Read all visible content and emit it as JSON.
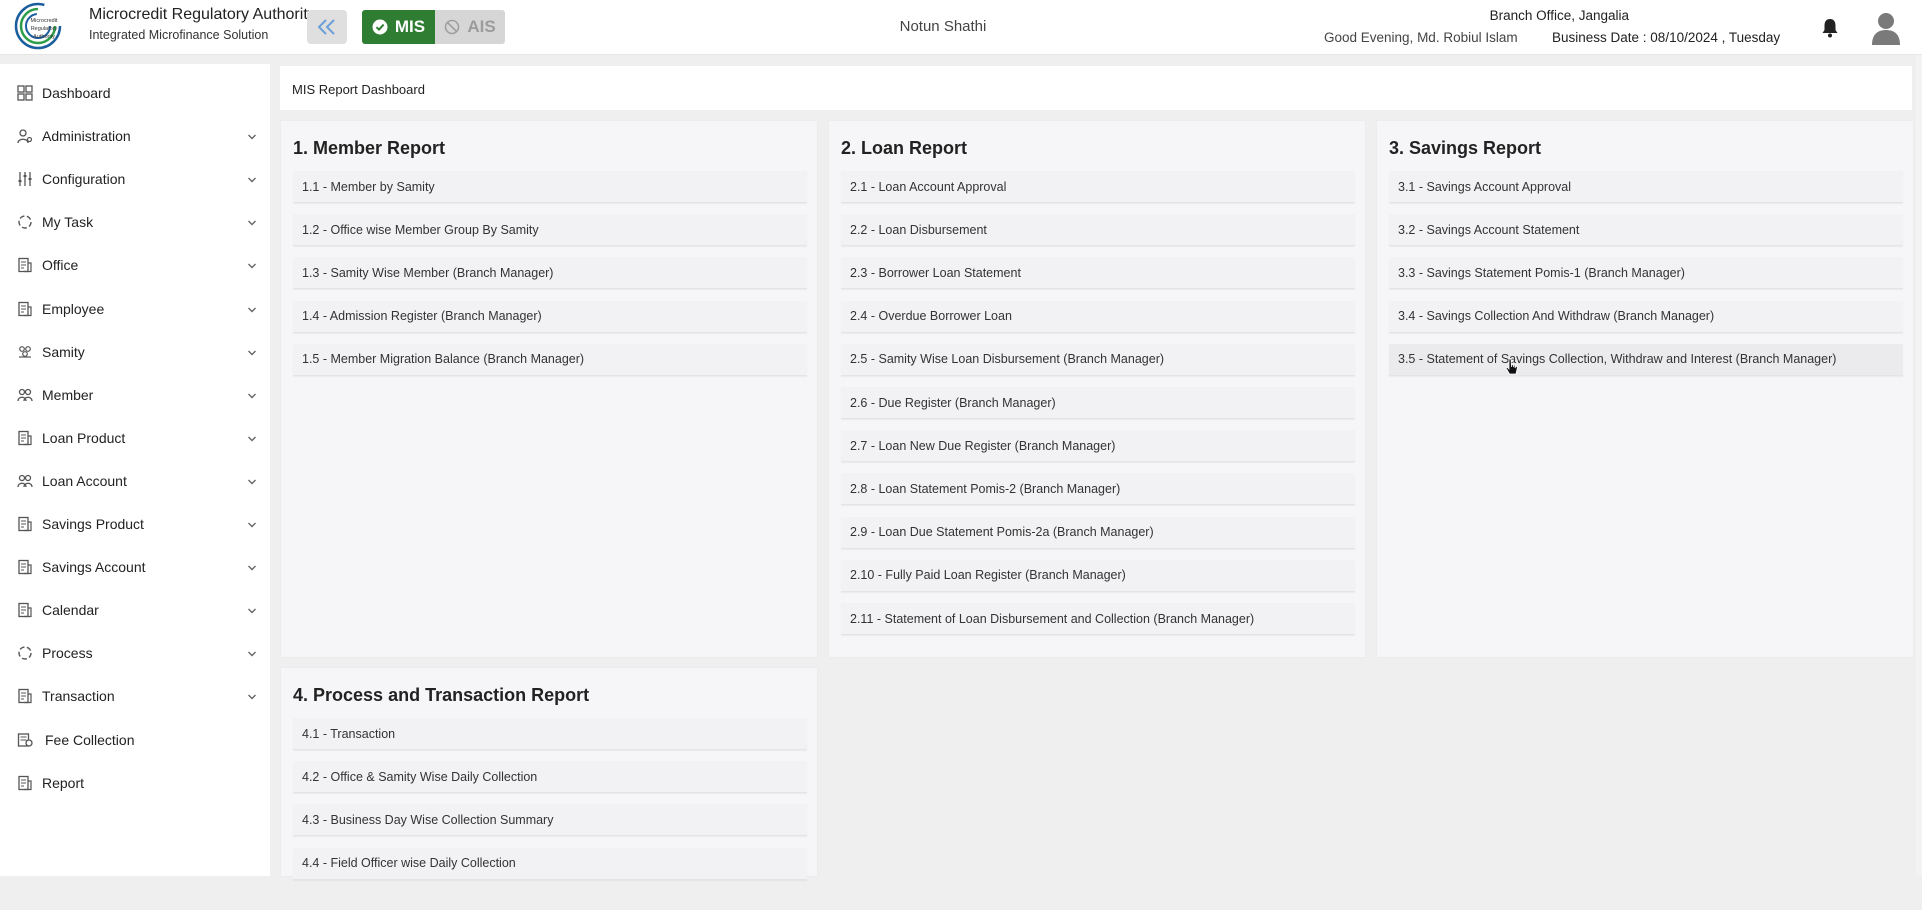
{
  "header": {
    "brand_title": "Microcredit Regulatory Authority",
    "brand_subtitle": "Integrated Microfinance Solution",
    "logo_text_lines": [
      "Microcredit",
      "Regulatory",
      "Authority"
    ],
    "mis_label": "MIS",
    "ais_label": "AIS",
    "center_title": "Notun Shathi",
    "greeting": "Good Evening, Md. Robiul Islam",
    "branch": "Branch Office, Jangalia",
    "business_date": "Business Date : 08/10/2024 , Tuesday",
    "accent_color": "#2e7d32"
  },
  "sidebar": {
    "items": [
      {
        "label": "Dashboard",
        "icon": "grid-icon",
        "expandable": false
      },
      {
        "label": "Administration",
        "icon": "user-gear-icon",
        "expandable": true
      },
      {
        "label": "Configuration",
        "icon": "sliders-icon",
        "expandable": true
      },
      {
        "label": "My Task",
        "icon": "circle-dashed-icon",
        "expandable": true
      },
      {
        "label": "Office",
        "icon": "document-icon",
        "expandable": true
      },
      {
        "label": "Employee",
        "icon": "document-icon",
        "expandable": true
      },
      {
        "label": "Samity",
        "icon": "group-icon",
        "expandable": true
      },
      {
        "label": "Member",
        "icon": "users-icon",
        "expandable": true
      },
      {
        "label": "Loan Product",
        "icon": "document-icon",
        "expandable": true
      },
      {
        "label": "Loan Account",
        "icon": "users-icon",
        "expandable": true
      },
      {
        "label": "Savings Product",
        "icon": "document-icon",
        "expandable": true
      },
      {
        "label": "Savings Account",
        "icon": "document-icon",
        "expandable": true
      },
      {
        "label": "Calendar",
        "icon": "document-icon",
        "expandable": true
      },
      {
        "label": "Process",
        "icon": "circle-dashed-icon",
        "expandable": true
      },
      {
        "label": "Transaction",
        "icon": "document-icon",
        "expandable": true
      },
      {
        "label": "Fee Collection",
        "icon": "cash-icon",
        "expandable": false
      },
      {
        "label": "Report",
        "icon": "document-icon",
        "expandable": false
      }
    ]
  },
  "main": {
    "page_title": "MIS Report Dashboard",
    "panels": [
      {
        "title": "1. Member Report",
        "items": [
          "1.1 - Member by Samity",
          "1.2 - Office wise Member Group By Samity",
          "1.3 - Samity Wise Member (Branch Manager)",
          "1.4 - Admission Register (Branch Manager)",
          "1.5 - Member Migration Balance (Branch Manager)"
        ]
      },
      {
        "title": "2. Loan Report",
        "items": [
          "2.1 - Loan Account Approval",
          "2.2 - Loan Disbursement",
          "2.3 - Borrower Loan Statement",
          "2.4 - Overdue Borrower Loan",
          "2.5 - Samity Wise Loan Disbursement (Branch Manager)",
          "2.6 - Due Register (Branch Manager)",
          "2.7 - Loan New Due Register (Branch Manager)",
          "2.8 - Loan Statement Pomis-2 (Branch Manager)",
          "2.9 - Loan Due Statement Pomis-2a (Branch Manager)",
          "2.10 - Fully Paid Loan Register (Branch Manager)",
          "2.11 - Statement of Loan Disbursement and Collection (Branch Manager)"
        ]
      },
      {
        "title": "3. Savings Report",
        "items": [
          "3.1 - Savings Account Approval",
          "3.2 - Savings Account Statement",
          "3.3 - Savings Statement Pomis-1 (Branch Manager)",
          "3.4 - Savings Collection And Withdraw (Branch Manager)",
          "3.5 - Statement of Savings Collection, Withdraw and Interest (Branch Manager)"
        ]
      },
      {
        "title": "4. Process and Transaction Report",
        "items": [
          "4.1 - Transaction",
          "4.2 - Office & Samity Wise Daily Collection",
          "4.3 - Business Day Wise Collection Summary",
          "4.4 - Field Officer wise Daily Collection"
        ]
      }
    ]
  }
}
